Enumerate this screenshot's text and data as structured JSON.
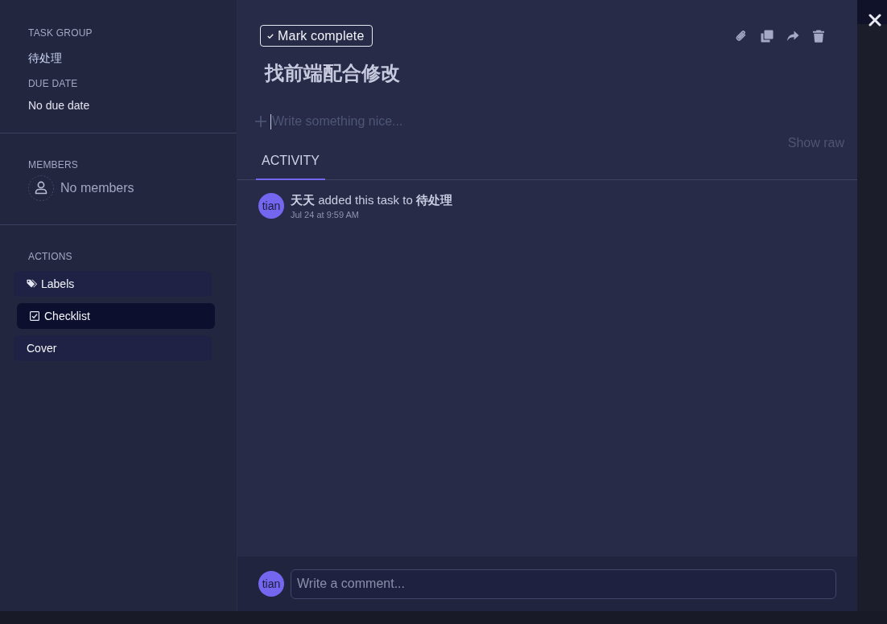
{
  "sidebar": {
    "task_group": {
      "label": "TASK GROUP",
      "value": "待处理"
    },
    "due_date": {
      "label": "DUE DATE",
      "value": "No due date"
    },
    "members": {
      "label": "MEMBERS",
      "value": "No members"
    },
    "actions": {
      "label": "ACTIONS",
      "items": [
        {
          "kind": "labels",
          "label": "Labels",
          "hovered": false
        },
        {
          "kind": "checklist",
          "label": "Checklist",
          "hovered": true
        },
        {
          "kind": "cover",
          "label": "Cover",
          "hovered": false
        }
      ]
    }
  },
  "task": {
    "mark_complete": "Mark complete",
    "title": "找前端配合修改",
    "description": {
      "placeholder": "Write something nice..."
    },
    "show_raw": "Show raw"
  },
  "tabs": [
    {
      "label": "ACTIVITY",
      "selected": true
    }
  ],
  "activity": [
    {
      "avatar": "tian",
      "text": "**天天** added this task to **待处理**",
      "time": "Jul 24 at 9:59 AM"
    }
  ],
  "comment": {
    "avatar": "tian",
    "placeholder": "Write a comment..."
  }
}
